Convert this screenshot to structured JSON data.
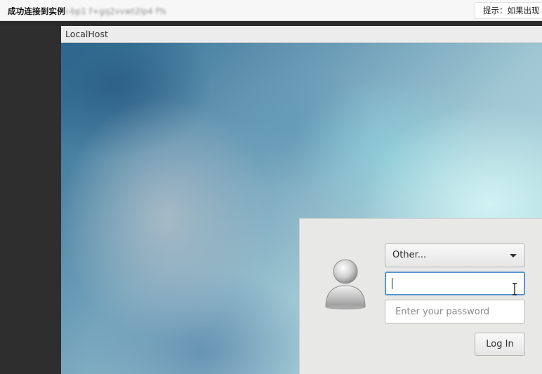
{
  "topbar": {
    "status_text": "成功连接到实例",
    "instance_id": "i-bp1 f+gq2vvwt2lp4 f%",
    "tip_text": "提示：如果出现"
  },
  "vm": {
    "title": "LocalHost"
  },
  "login": {
    "user_select_value": "Other...",
    "username_value": "",
    "password_placeholder": "Enter your password",
    "login_button_label": "Log In",
    "avatar_icon": "user-avatar-icon",
    "username_focus_color": "#5b94d1"
  },
  "colors": {
    "left_panel": "#2e2e2e",
    "login_panel": "#e8e8e7"
  }
}
